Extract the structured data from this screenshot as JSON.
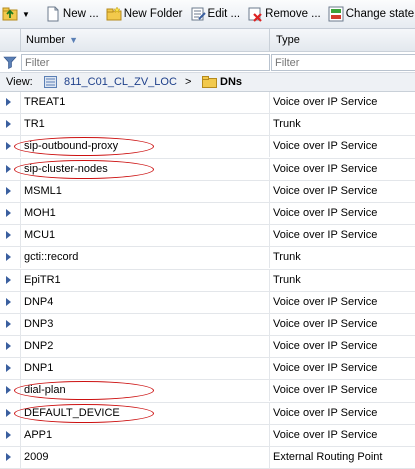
{
  "toolbar": {
    "new_label": "New ...",
    "new_folder_label": "New Folder",
    "edit_label": "Edit ...",
    "remove_label": "Remove ...",
    "change_state_label": "Change state"
  },
  "table": {
    "col_number": "Number",
    "col_type": "Type",
    "filter_placeholder": "Filter"
  },
  "view": {
    "label": "View:",
    "switch": "811_C01_CL_ZV_LOC",
    "separator": ">",
    "folder": "DNs"
  },
  "rows": [
    {
      "number": "TREAT1",
      "type": "Voice over IP Service",
      "circled": false
    },
    {
      "number": "TR1",
      "type": "Trunk",
      "circled": false
    },
    {
      "number": "sip-outbound-proxy",
      "type": "Voice over IP Service",
      "circled": true
    },
    {
      "number": "sip-cluster-nodes",
      "type": "Voice over IP Service",
      "circled": true
    },
    {
      "number": "MSML1",
      "type": "Voice over IP Service",
      "circled": false
    },
    {
      "number": "MOH1",
      "type": "Voice over IP Service",
      "circled": false
    },
    {
      "number": "MCU1",
      "type": "Voice over IP Service",
      "circled": false
    },
    {
      "number": "gcti::record",
      "type": "Trunk",
      "circled": false
    },
    {
      "number": "EpiTR1",
      "type": "Trunk",
      "circled": false
    },
    {
      "number": "DNP4",
      "type": "Voice over IP Service",
      "circled": false
    },
    {
      "number": "DNP3",
      "type": "Voice over IP Service",
      "circled": false
    },
    {
      "number": "DNP2",
      "type": "Voice over IP Service",
      "circled": false
    },
    {
      "number": "DNP1",
      "type": "Voice over IP Service",
      "circled": false
    },
    {
      "number": "dial-plan",
      "type": "Voice over IP Service",
      "circled": true
    },
    {
      "number": "DEFAULT_DEVICE",
      "type": "Voice over IP Service",
      "circled": true
    },
    {
      "number": "APP1",
      "type": "Voice over IP Service",
      "circled": false
    },
    {
      "number": "2009",
      "type": "External Routing Point",
      "circled": false
    }
  ],
  "colors": {
    "annotation": "#cc1111",
    "row_arrow": "#3a5f9f",
    "toolbar_bg": "#e6ebf1"
  }
}
